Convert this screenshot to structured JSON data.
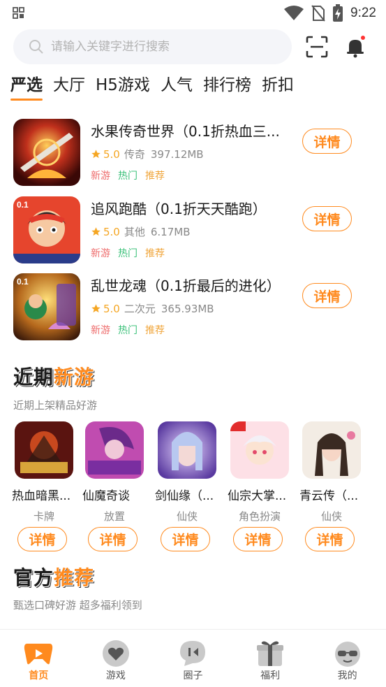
{
  "status_bar": {
    "time": "9:22"
  },
  "search": {
    "placeholder": "请输入关键字进行搜索"
  },
  "tabs": [
    {
      "label": "严选",
      "active": true
    },
    {
      "label": "大厅"
    },
    {
      "label": "H5游戏"
    },
    {
      "label": "人气"
    },
    {
      "label": "排行榜"
    },
    {
      "label": "折扣"
    }
  ],
  "games": [
    {
      "title": "水果传奇世界（0.1折热血三...",
      "rating": "5.0",
      "genre": "传奇",
      "size": "397.12MB",
      "tags": [
        "新游",
        "热门",
        "推荐"
      ],
      "button": "详情"
    },
    {
      "title": "追风跑酷（0.1折天天酷跑）",
      "rating": "5.0",
      "genre": "其他",
      "size": "6.17MB",
      "tags": [
        "新游",
        "热门",
        "推荐"
      ],
      "button": "详情"
    },
    {
      "title": "乱世龙魂（0.1折最后的进化）",
      "rating": "5.0",
      "genre": "二次元",
      "size": "365.93MB",
      "tags": [
        "新游",
        "热门",
        "推荐"
      ],
      "button": "详情"
    }
  ],
  "new_games_section": {
    "title_main": "近期",
    "title_highlight": "新游",
    "subtitle": "近期上架精品好游",
    "items": [
      {
        "name": "热血暗黑...",
        "category": "卡牌",
        "button": "详情"
      },
      {
        "name": "仙魔奇谈",
        "category": "放置",
        "button": "详情"
      },
      {
        "name": "剑仙缘（...",
        "category": "仙侠",
        "button": "详情"
      },
      {
        "name": "仙宗大掌...",
        "category": "角色扮演",
        "button": "详情"
      },
      {
        "name": "青云传（...",
        "category": "仙侠",
        "button": "详情"
      }
    ]
  },
  "official_section": {
    "title_main": "官方",
    "title_highlight": "推荐",
    "subtitle": "甄选口碑好游 超多福利领到"
  },
  "bottom_nav": [
    {
      "label": "首页",
      "icon": "home-gamepad-icon",
      "active": true
    },
    {
      "label": "游戏",
      "icon": "game-heart-icon"
    },
    {
      "label": "圈子",
      "icon": "chat-bubble-icon"
    },
    {
      "label": "福利",
      "icon": "gift-icon"
    },
    {
      "label": "我的",
      "icon": "profile-face-icon"
    }
  ],
  "colors": {
    "accent": "#ff8a1e",
    "tag_new": "#ee6d6d",
    "tag_hot": "#3cc17a",
    "tag_rec": "#f0a53a",
    "star": "#f5a623"
  }
}
